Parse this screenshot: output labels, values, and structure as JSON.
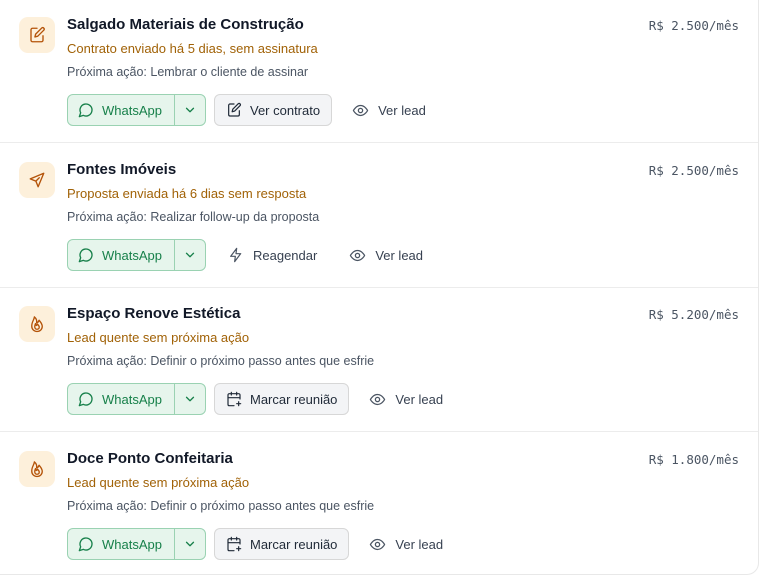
{
  "colors": {
    "status_text": "#a16207",
    "icon_bg": "#fdf0db",
    "icon_stroke": "#b45309",
    "whatsapp_bg": "#e6f5ec",
    "whatsapp_text": "#17804a",
    "whatsapp_border": "#9ad2b2"
  },
  "leads": [
    {
      "icon": "file-edit-icon",
      "name": "Salgado Materiais de Construção",
      "price": "R$ 2.500/mês",
      "status": "Contrato enviado há 5 dias, sem assinatura",
      "next_action": "Próxima ação: Lembrar o cliente de assinar",
      "whatsapp_label": "WhatsApp",
      "secondary": {
        "label": "Ver contrato",
        "icon": "file-edit-icon",
        "style": "outline"
      },
      "view_label": "Ver lead"
    },
    {
      "icon": "send-icon",
      "name": "Fontes Imóveis",
      "price": "R$ 2.500/mês",
      "status": "Proposta enviada há 6 dias sem resposta",
      "next_action": "Próxima ação: Realizar follow-up da proposta",
      "whatsapp_label": "WhatsApp",
      "secondary": {
        "label": "Reagendar",
        "icon": "zap-icon",
        "style": "ghost"
      },
      "view_label": "Ver lead"
    },
    {
      "icon": "flame-icon",
      "name": "Espaço Renove Estética",
      "price": "R$ 5.200/mês",
      "status": "Lead quente sem próxima ação",
      "next_action": "Próxima ação: Definir o próximo passo antes que esfrie",
      "whatsapp_label": "WhatsApp",
      "secondary": {
        "label": "Marcar reunião",
        "icon": "calendar-plus-icon",
        "style": "outline"
      },
      "view_label": "Ver lead"
    },
    {
      "icon": "flame-icon",
      "name": "Doce Ponto Confeitaria",
      "price": "R$ 1.800/mês",
      "status": "Lead quente sem próxima ação",
      "next_action": "Próxima ação: Definir o próximo passo antes que esfrie",
      "whatsapp_label": "WhatsApp",
      "secondary": {
        "label": "Marcar reunião",
        "icon": "calendar-plus-icon",
        "style": "outline"
      },
      "view_label": "Ver lead"
    }
  ]
}
